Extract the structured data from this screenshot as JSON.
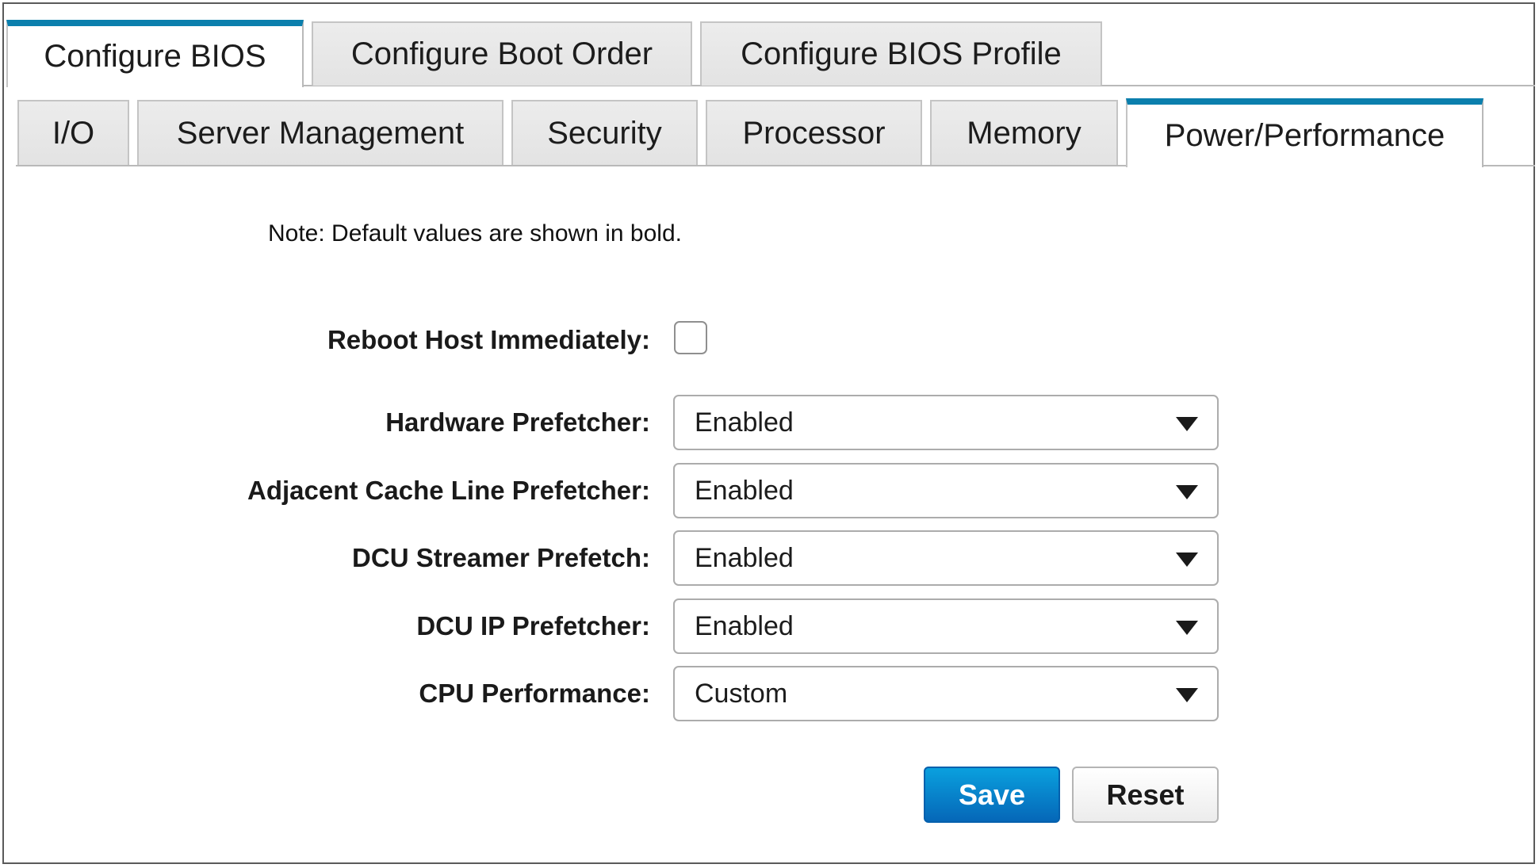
{
  "top_tabs": [
    {
      "label": "Configure BIOS",
      "active": true
    },
    {
      "label": "Configure Boot Order",
      "active": false
    },
    {
      "label": "Configure BIOS Profile",
      "active": false
    }
  ],
  "sub_tabs": [
    {
      "label": "I/O",
      "active": false
    },
    {
      "label": "Server Management",
      "active": false
    },
    {
      "label": "Security",
      "active": false
    },
    {
      "label": "Processor",
      "active": false
    },
    {
      "label": "Memory",
      "active": false
    },
    {
      "label": "Power/Performance",
      "active": true
    }
  ],
  "note": "Note: Default values are shown in bold.",
  "form": {
    "reboot": {
      "label": "Reboot Host Immediately:",
      "checked": false
    },
    "fields": [
      {
        "label": "Hardware Prefetcher:",
        "value": "Enabled",
        "icon": "dropdown-arrow-icon"
      },
      {
        "label": "Adjacent Cache Line Prefetcher:",
        "value": "Enabled",
        "icon": "dropdown-arrow-icon"
      },
      {
        "label": "DCU Streamer Prefetch:",
        "value": "Enabled",
        "icon": "dropdown-arrow-icon"
      },
      {
        "label": "DCU IP Prefetcher:",
        "value": "Enabled",
        "icon": "dropdown-arrow-icon"
      },
      {
        "label": "CPU Performance:",
        "value": "Custom",
        "icon": "dropdown-arrow-icon"
      }
    ]
  },
  "buttons": {
    "save": "Save",
    "reset": "Reset"
  },
  "colors": {
    "accent": "#0b7fad",
    "save_button": "#0580c8"
  }
}
